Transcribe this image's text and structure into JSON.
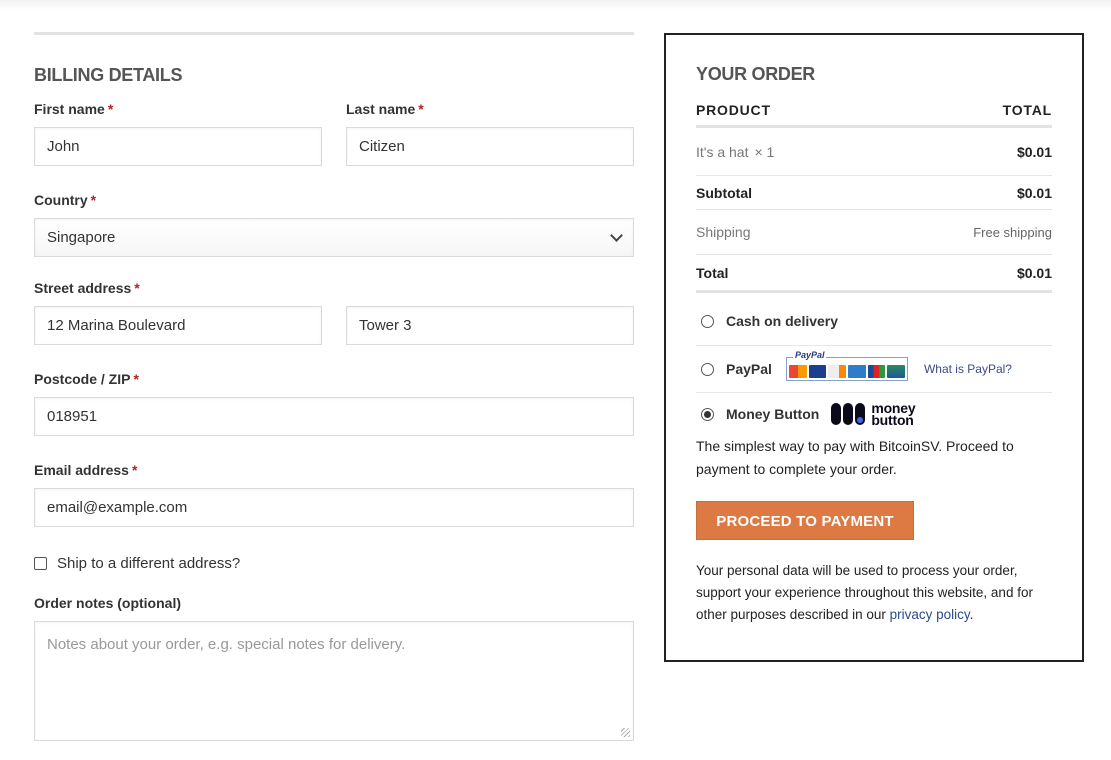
{
  "billing": {
    "title": "BILLING DETAILS",
    "required_mark": "*",
    "first_name": {
      "label": "First name",
      "value": "John"
    },
    "last_name": {
      "label": "Last name",
      "value": "Citizen"
    },
    "country": {
      "label": "Country",
      "value": "Singapore"
    },
    "street": {
      "label": "Street address",
      "line1": "12 Marina Boulevard",
      "line2": "Tower 3"
    },
    "postcode": {
      "label": "Postcode / ZIP",
      "value": "018951"
    },
    "email": {
      "label": "Email address",
      "value": "email@example.com"
    },
    "ship_different": {
      "label": "Ship to a different address?",
      "checked": false
    },
    "notes": {
      "label": "Order notes (optional)",
      "placeholder": "Notes about your order, e.g. special notes for delivery."
    }
  },
  "order": {
    "title": "YOUR ORDER",
    "headers": {
      "product": "PRODUCT",
      "total": "TOTAL"
    },
    "item": {
      "name": "It's a hat",
      "qty": "× 1",
      "amount": "$0.01"
    },
    "subtotal": {
      "label": "Subtotal",
      "amount": "$0.01"
    },
    "shipping": {
      "label": "Shipping",
      "value": "Free shipping"
    },
    "total": {
      "label": "Total",
      "amount": "$0.01"
    },
    "payments": {
      "cod": {
        "label": "Cash on delivery",
        "selected": false
      },
      "paypal": {
        "label": "PayPal",
        "badge_text": "PayPal",
        "what_link": "What is PayPal?",
        "selected": false
      },
      "moneybutton": {
        "label": "Money Button",
        "logo_line1": "money",
        "logo_line2": "button",
        "selected": true
      }
    },
    "description": "The simplest way to pay with BitcoinSV. Proceed to payment to complete your order.",
    "proceed_button": "PROCEED TO PAYMENT",
    "privacy_text": "Your personal data will be used to process your order, support your experience throughout this website, and for other purposes described in our",
    "privacy_link": "privacy policy",
    "privacy_end": "."
  },
  "colors": {
    "accent_button": "#dd7a44",
    "required": "#b22222",
    "link": "#2b4b8c",
    "moneybutton_dot": "#3e68f0"
  },
  "icons": {
    "select_arrow": "chevron-down-icon",
    "card_logos": [
      "mastercard-icon",
      "visa-icon",
      "discover-icon",
      "amex-icon",
      "jcb-icon",
      "card-icon"
    ]
  }
}
